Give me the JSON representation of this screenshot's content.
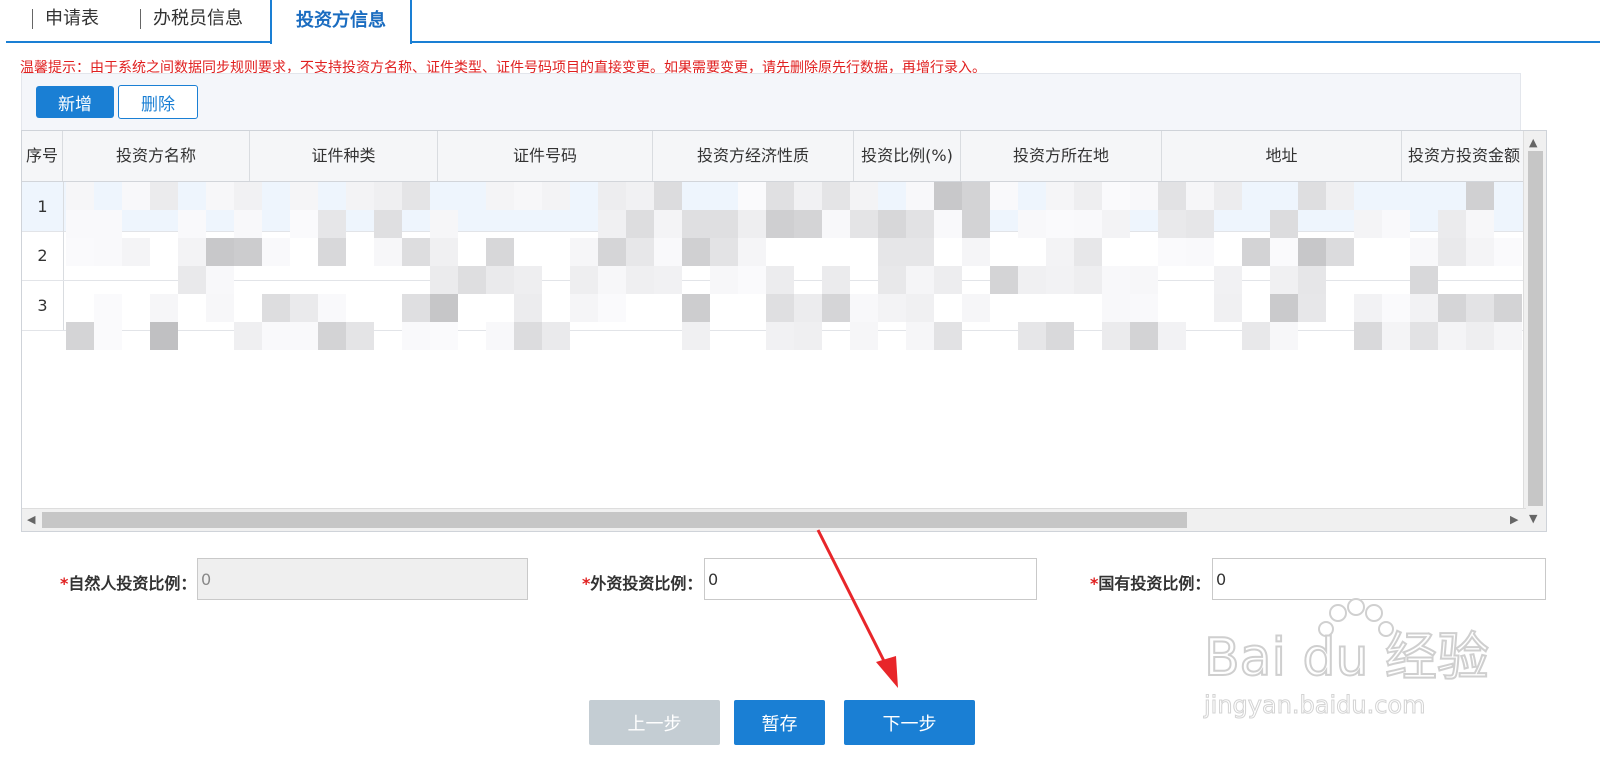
{
  "tabs": [
    {
      "label": "申请表"
    },
    {
      "label": "办税员信息"
    },
    {
      "label": "投资方信息"
    }
  ],
  "notice": "温馨提示：由于系统之间数据同步规则要求，不支持投资方名称、证件类型、证件号码项目的直接变更。如果需要变更，请先删除原先行数据，再增行录入。",
  "toolbar": {
    "add_label": "新增",
    "delete_label": "删除"
  },
  "table": {
    "columns": [
      "序号",
      "投资方名称",
      "证件种类",
      "证件号码",
      "投资方经济性质",
      "投资比例(%)",
      "投资方所在地",
      "地址",
      "投资方投资金额"
    ],
    "rows": [
      {
        "index": "1"
      },
      {
        "index": "2"
      },
      {
        "index": "3"
      }
    ]
  },
  "ratios": {
    "natural": {
      "required_mark": "*",
      "label": "自然人投资比例：",
      "value": "0"
    },
    "foreign": {
      "required_mark": "*",
      "label": "外资投资比例：",
      "value": "0"
    },
    "state": {
      "required_mark": "*",
      "label": "国有投资比例：",
      "value": "0"
    }
  },
  "buttons": {
    "prev": "上一步",
    "save": "暂存",
    "next": "下一步"
  },
  "colors": {
    "accent": "#1a7fd4",
    "warning": "#e02020",
    "disabled_button": "#c4cdd3",
    "annotation_arrow": "#e8262a"
  },
  "watermark": {
    "brand": "Bai du 经验",
    "url": "jingyan.baidu.com"
  }
}
